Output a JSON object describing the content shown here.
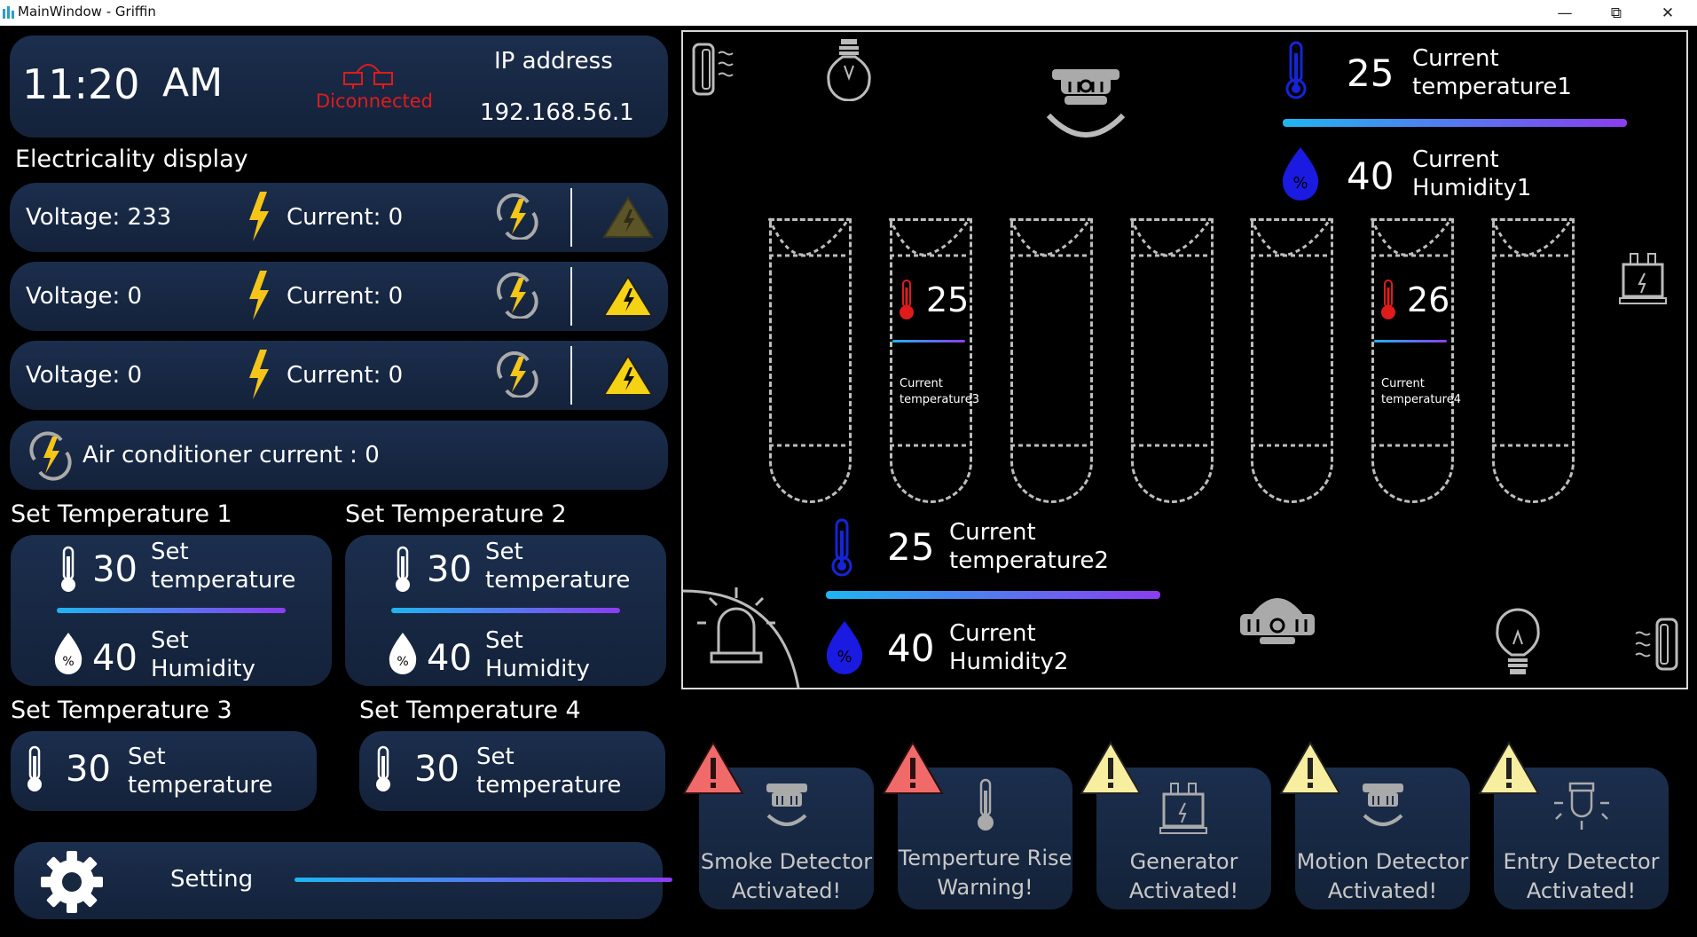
{
  "window": {
    "title": "MainWindow - Griffin"
  },
  "status": {
    "time": "11:20",
    "ampm": "AM",
    "connection": "Diconnected",
    "ip_label": "IP address",
    "ip_value": "192.168.56.1"
  },
  "electricity": {
    "title": "Electricality display",
    "rows": [
      {
        "voltage": "Voltage: 233",
        "current": "Current: 0",
        "warning": "dim"
      },
      {
        "voltage": "Voltage: 0",
        "current": "Current: 0",
        "warning": "active"
      },
      {
        "voltage": "Voltage: 0",
        "current": "Current: 0",
        "warning": "active"
      }
    ],
    "ac_current": "Air conditioner current : 0"
  },
  "setpoints": [
    {
      "title": "Set Temperature 1",
      "temp": "30",
      "temp_label_1": "Set",
      "temp_label_2": "temperature",
      "hum": "40",
      "hum_label_1": "Set",
      "hum_label_2": "Humidity"
    },
    {
      "title": "Set Temperature 2",
      "temp": "30",
      "temp_label_1": "Set",
      "temp_label_2": "temperature",
      "hum": "40",
      "hum_label_1": "Set",
      "hum_label_2": "Humidity"
    },
    {
      "title": "Set Temperature 3",
      "temp": "30",
      "temp_label_1": "Set",
      "temp_label_2": "temperature"
    },
    {
      "title": "Set Temperature 4",
      "temp": "30",
      "temp_label_1": "Set",
      "temp_label_2": "temperature"
    }
  ],
  "setting": {
    "label": "Setting"
  },
  "scene": {
    "temp1": {
      "value": "25",
      "label_1": "Current",
      "label_2": "temperature1"
    },
    "hum1": {
      "value": "40",
      "label_1": "Current",
      "label_2": "Humidity1"
    },
    "temp2": {
      "value": "25",
      "label_1": "Current",
      "label_2": "temperature2"
    },
    "hum2": {
      "value": "40",
      "label_1": "Current",
      "label_2": "Humidity2"
    },
    "temp3": {
      "value": "25",
      "label_1": "Current",
      "label_2": "temperature3"
    },
    "temp4": {
      "value": "26",
      "label_1": "Current",
      "label_2": "temperature4"
    },
    "percent_glyph": "%"
  },
  "alerts": [
    {
      "line1": "Smoke Detector",
      "line2": "Activated!",
      "level": "red",
      "icon": "smoke-detector-icon"
    },
    {
      "line1": "Temperture Rise",
      "line2": "Warning!",
      "level": "red",
      "icon": "thermometer-icon"
    },
    {
      "line1": "Generator",
      "line2": "Activated!",
      "level": "yellow",
      "icon": "generator-icon"
    },
    {
      "line1": "Motion Detector",
      "line2": "Activated!",
      "level": "yellow",
      "icon": "motion-detector-icon"
    },
    {
      "line1": "Entry Detector",
      "line2": "Activated!",
      "level": "yellow",
      "icon": "entry-detector-icon"
    }
  ],
  "colors": {
    "accent_gradient_start": "#1fb5f0",
    "accent_gradient_end": "#8b3df0",
    "disconnected": "#e01b1b",
    "lightning": "#f5c518",
    "warning_red": "#f06a6a",
    "warning_yellow": "#f7eea0"
  }
}
